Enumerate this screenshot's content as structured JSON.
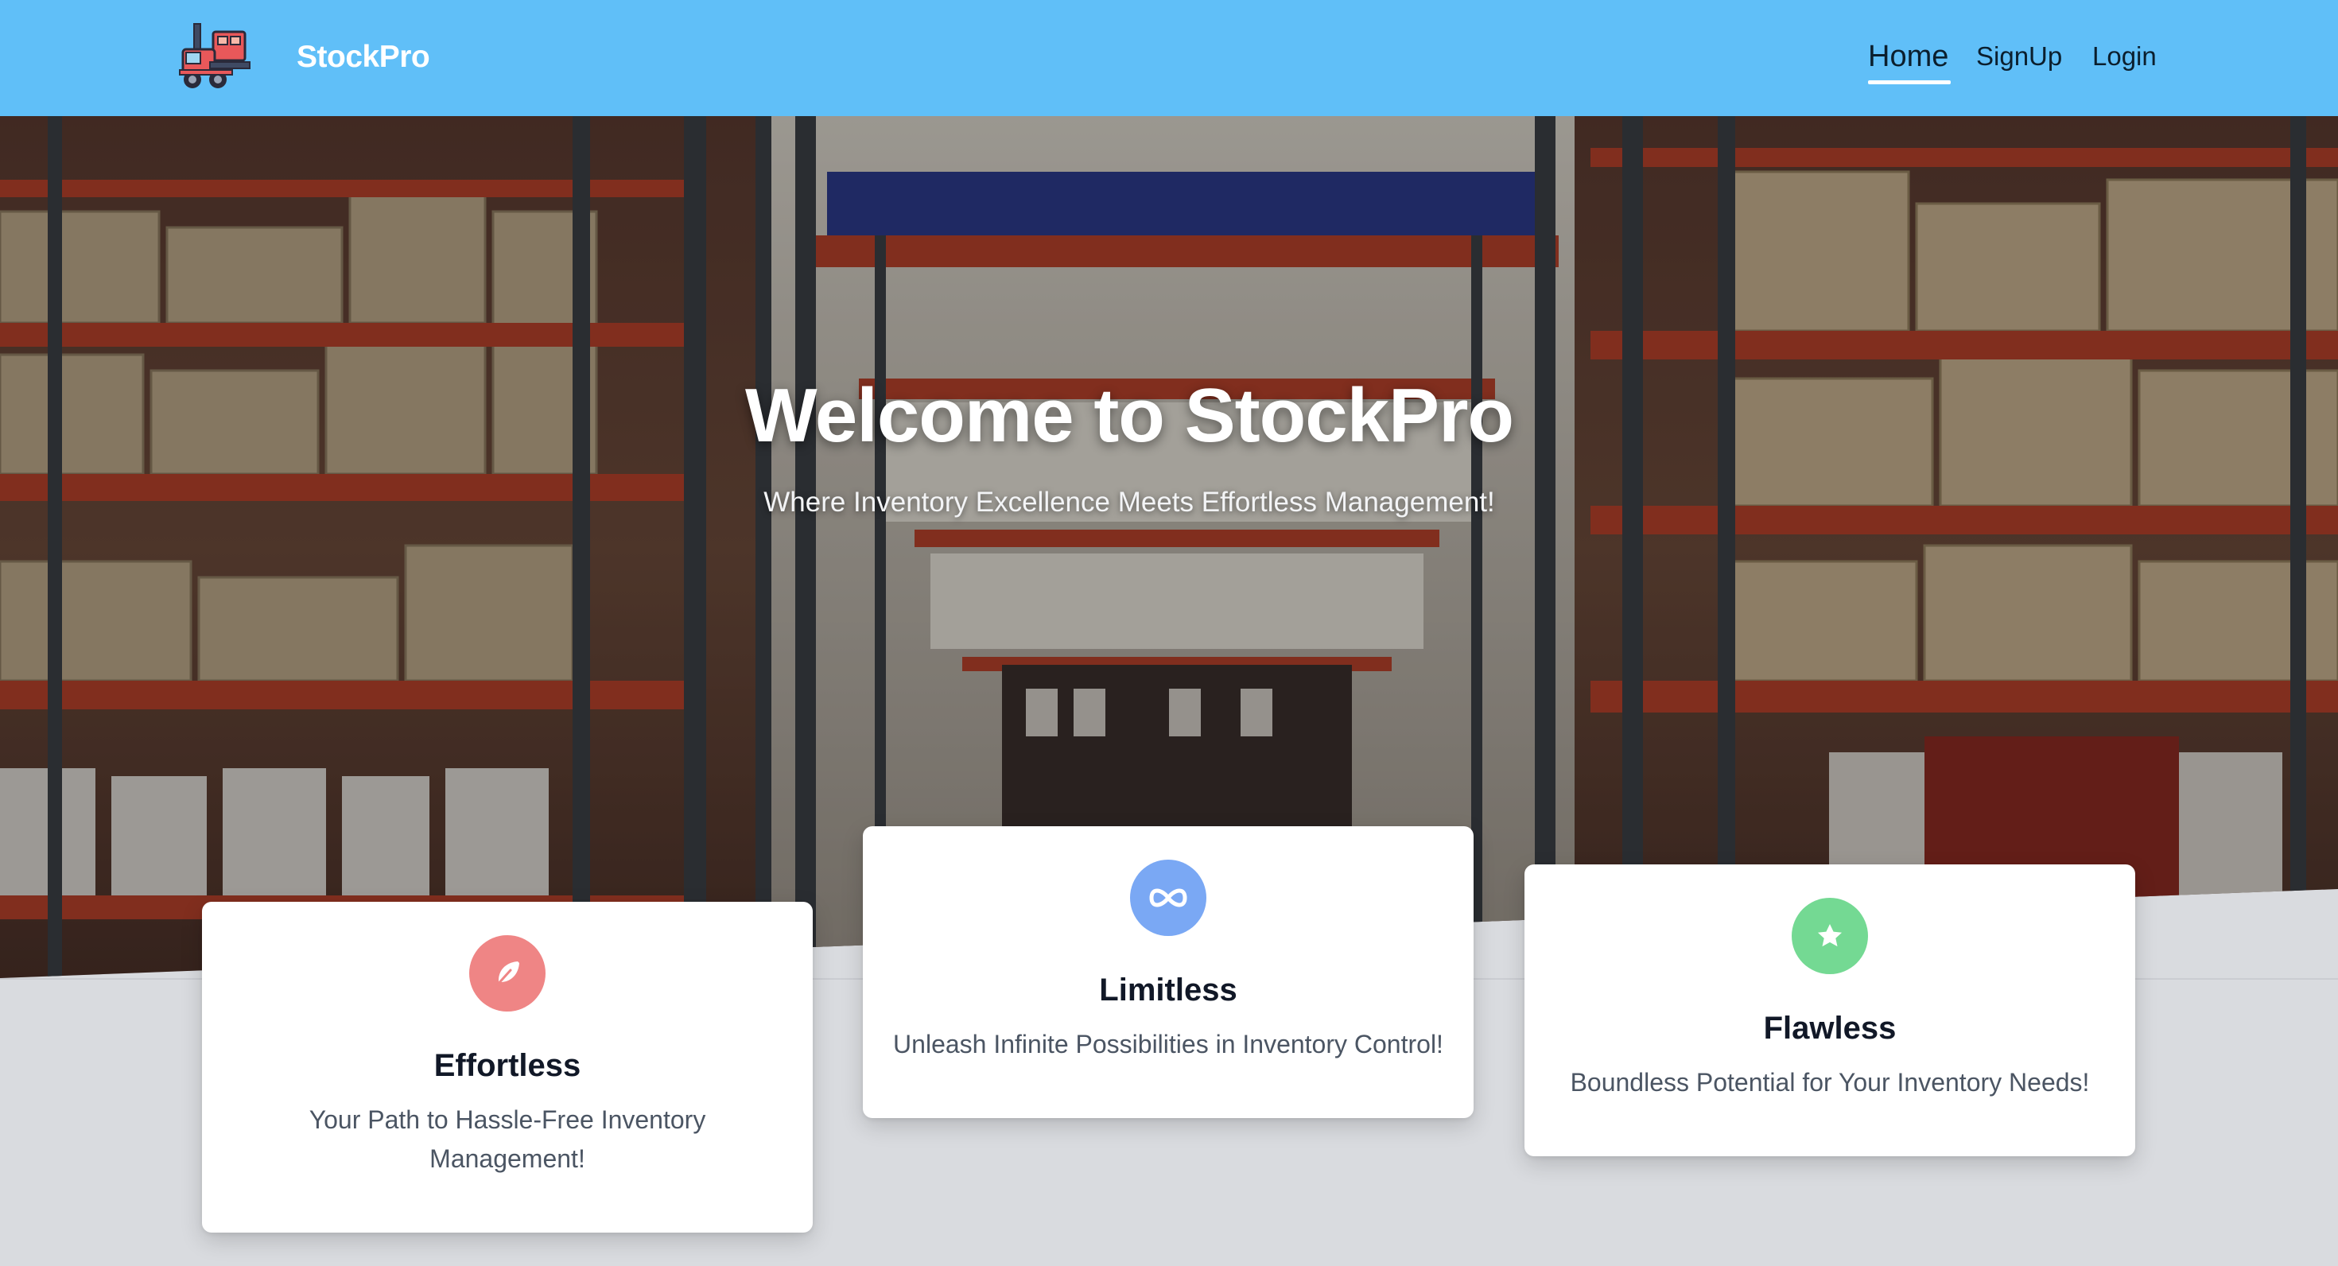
{
  "navbar": {
    "brand_name": "StockPro",
    "logo_icon": "forklift-icon",
    "links": [
      {
        "label": "Home",
        "active": true
      },
      {
        "label": "SignUp",
        "active": false
      },
      {
        "label": "Login",
        "active": false
      }
    ],
    "background_color": "#60bff8"
  },
  "hero": {
    "title": "Welcome to StockPro",
    "subtitle": "Where Inventory Excellence Meets Effortless Management!",
    "background": "warehouse-shelves-photo"
  },
  "features": [
    {
      "icon": "feather-icon",
      "icon_color": "#ef8585",
      "title": "Effortless",
      "text": "Your Path to Hassle-Free Inventory Management!"
    },
    {
      "icon": "infinity-icon",
      "icon_color": "#7aa8f4",
      "title": "Limitless",
      "text": "Unleash Infinite Possibilities in Inventory Control!"
    },
    {
      "icon": "star-icon",
      "icon_color": "#74d993",
      "title": "Flawless",
      "text": "Boundless Potential for Your Inventory Needs!"
    }
  ]
}
